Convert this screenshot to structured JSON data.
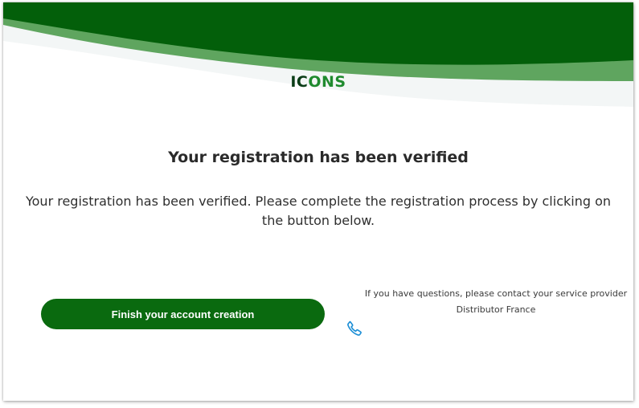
{
  "logo": {
    "part_dark": "IC",
    "part_light": "ONS",
    "part_dark_end": ""
  },
  "page": {
    "title": "Your registration has been verified",
    "message": "Your registration has been verified. Please complete the registration process by clicking on the button below."
  },
  "actions": {
    "finish_label": "Finish your account creation"
  },
  "contact": {
    "line1": "If you have questions, please contact your service provider",
    "line2": "Distributor France",
    "icon": "phone-icon"
  },
  "colors": {
    "primary_green": "#0a6a0f",
    "header_dark_green": "#035f0a",
    "header_light_green": "#5fa55f",
    "phone_blue": "#1e8fd6"
  }
}
